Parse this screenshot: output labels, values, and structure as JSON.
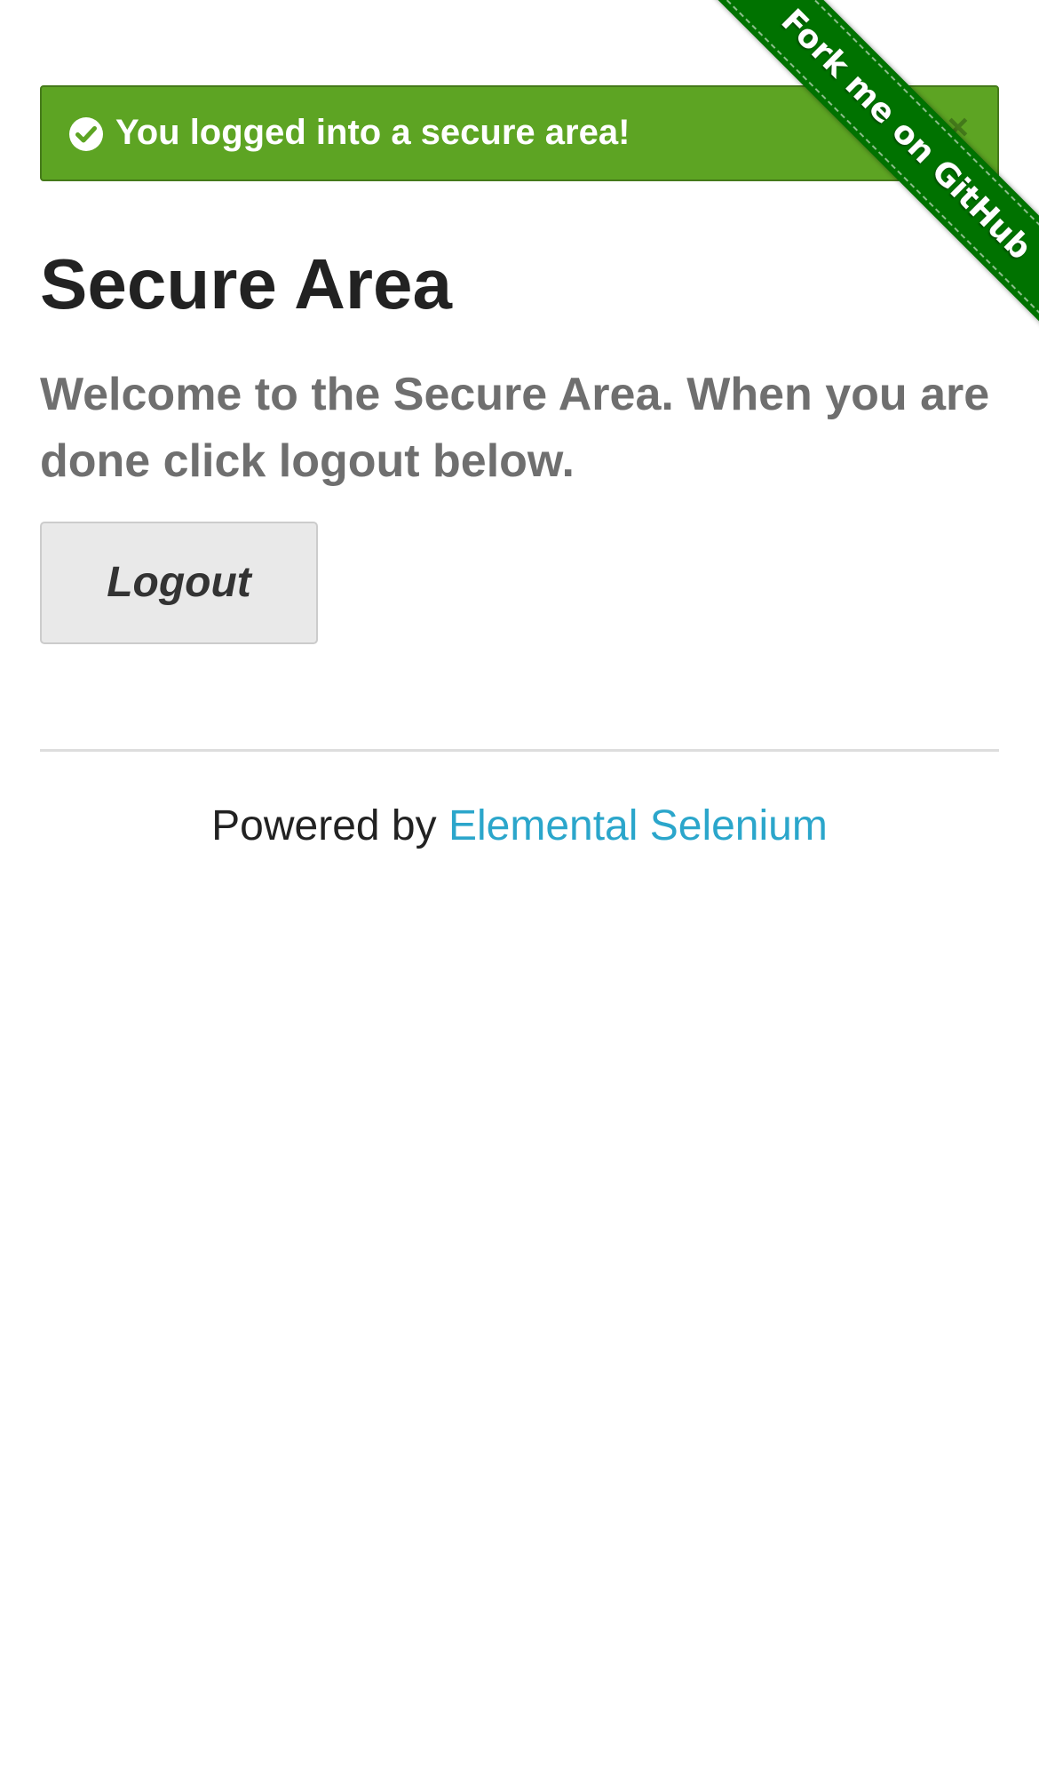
{
  "flash": {
    "icon": "check-circle-icon",
    "message": "You logged into a secure area!",
    "close_label": "×",
    "background_color": "#5da423"
  },
  "ribbon": {
    "label": "Fork me on GitHub",
    "color": "#007200"
  },
  "main": {
    "title": "Secure Area",
    "subheader": "Welcome to the Secure Area. When you are done click logout below.",
    "logout_label": "Logout"
  },
  "footer": {
    "prefix": "Powered by ",
    "link_label": "Elemental Selenium",
    "link_color": "#2ba6cb"
  }
}
